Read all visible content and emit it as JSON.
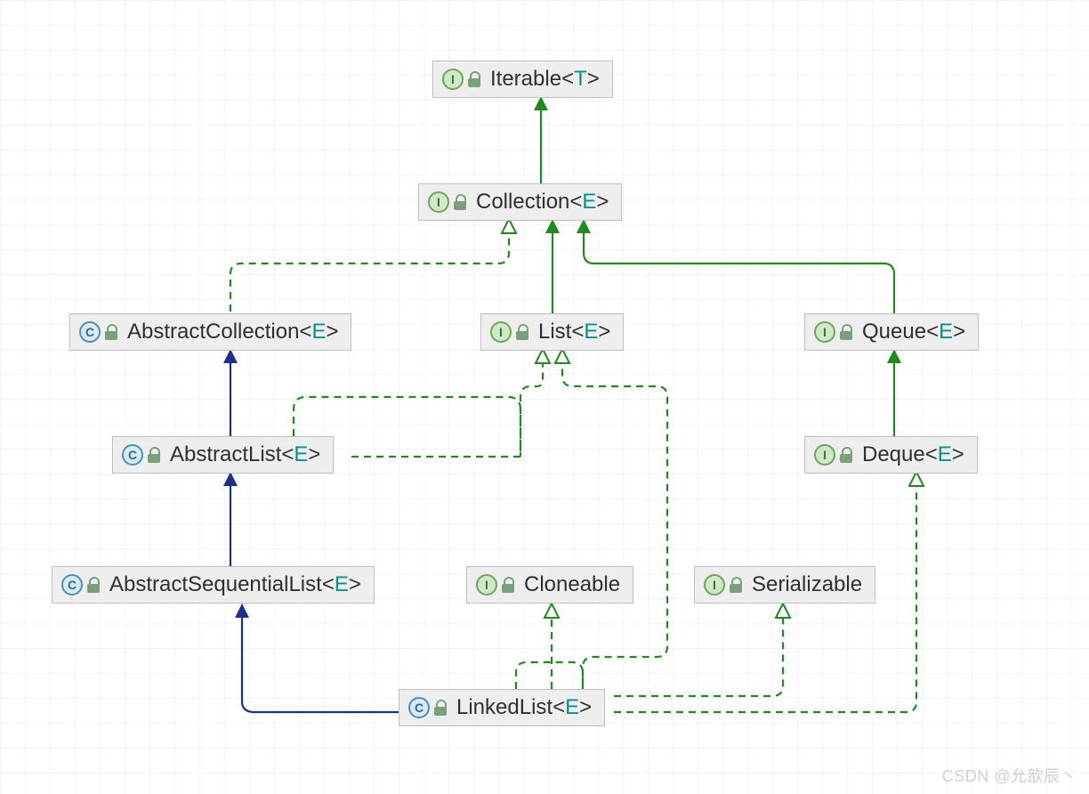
{
  "nodes": {
    "iterable": {
      "kind": "interface",
      "name": "Iterable",
      "param": "T"
    },
    "collection": {
      "kind": "interface",
      "name": "Collection",
      "param": "E"
    },
    "abscoll": {
      "kind": "class",
      "name": "AbstractCollection",
      "param": "E"
    },
    "list": {
      "kind": "interface",
      "name": "List",
      "param": "E"
    },
    "queue": {
      "kind": "interface",
      "name": "Queue",
      "param": "E"
    },
    "abslist": {
      "kind": "class",
      "name": "AbstractList",
      "param": "E"
    },
    "deque": {
      "kind": "interface",
      "name": "Deque",
      "param": "E"
    },
    "absseqlist": {
      "kind": "class",
      "name": "AbstractSequentialList",
      "param": "E"
    },
    "cloneable": {
      "kind": "interface",
      "name": "Cloneable",
      "param": ""
    },
    "serializable": {
      "kind": "interface",
      "name": "Serializable",
      "param": ""
    },
    "linkedlist": {
      "kind": "class",
      "name": "LinkedList",
      "param": "E"
    }
  },
  "relations": [
    {
      "from": "collection",
      "to": "iterable",
      "type": "extends-interface"
    },
    {
      "from": "list",
      "to": "collection",
      "type": "extends-interface"
    },
    {
      "from": "queue",
      "to": "collection",
      "type": "extends-interface"
    },
    {
      "from": "deque",
      "to": "queue",
      "type": "extends-interface"
    },
    {
      "from": "abscoll",
      "to": "collection",
      "type": "implements"
    },
    {
      "from": "abslist",
      "to": "abscoll",
      "type": "extends-class"
    },
    {
      "from": "abslist",
      "to": "list",
      "type": "implements"
    },
    {
      "from": "absseqlist",
      "to": "abslist",
      "type": "extends-class"
    },
    {
      "from": "linkedlist",
      "to": "absseqlist",
      "type": "extends-class"
    },
    {
      "from": "linkedlist",
      "to": "list",
      "type": "implements"
    },
    {
      "from": "linkedlist",
      "to": "cloneable",
      "type": "implements"
    },
    {
      "from": "linkedlist",
      "to": "serializable",
      "type": "implements"
    },
    {
      "from": "linkedlist",
      "to": "deque",
      "type": "implements"
    }
  ],
  "watermark": "CSDN @允歆辰丶"
}
